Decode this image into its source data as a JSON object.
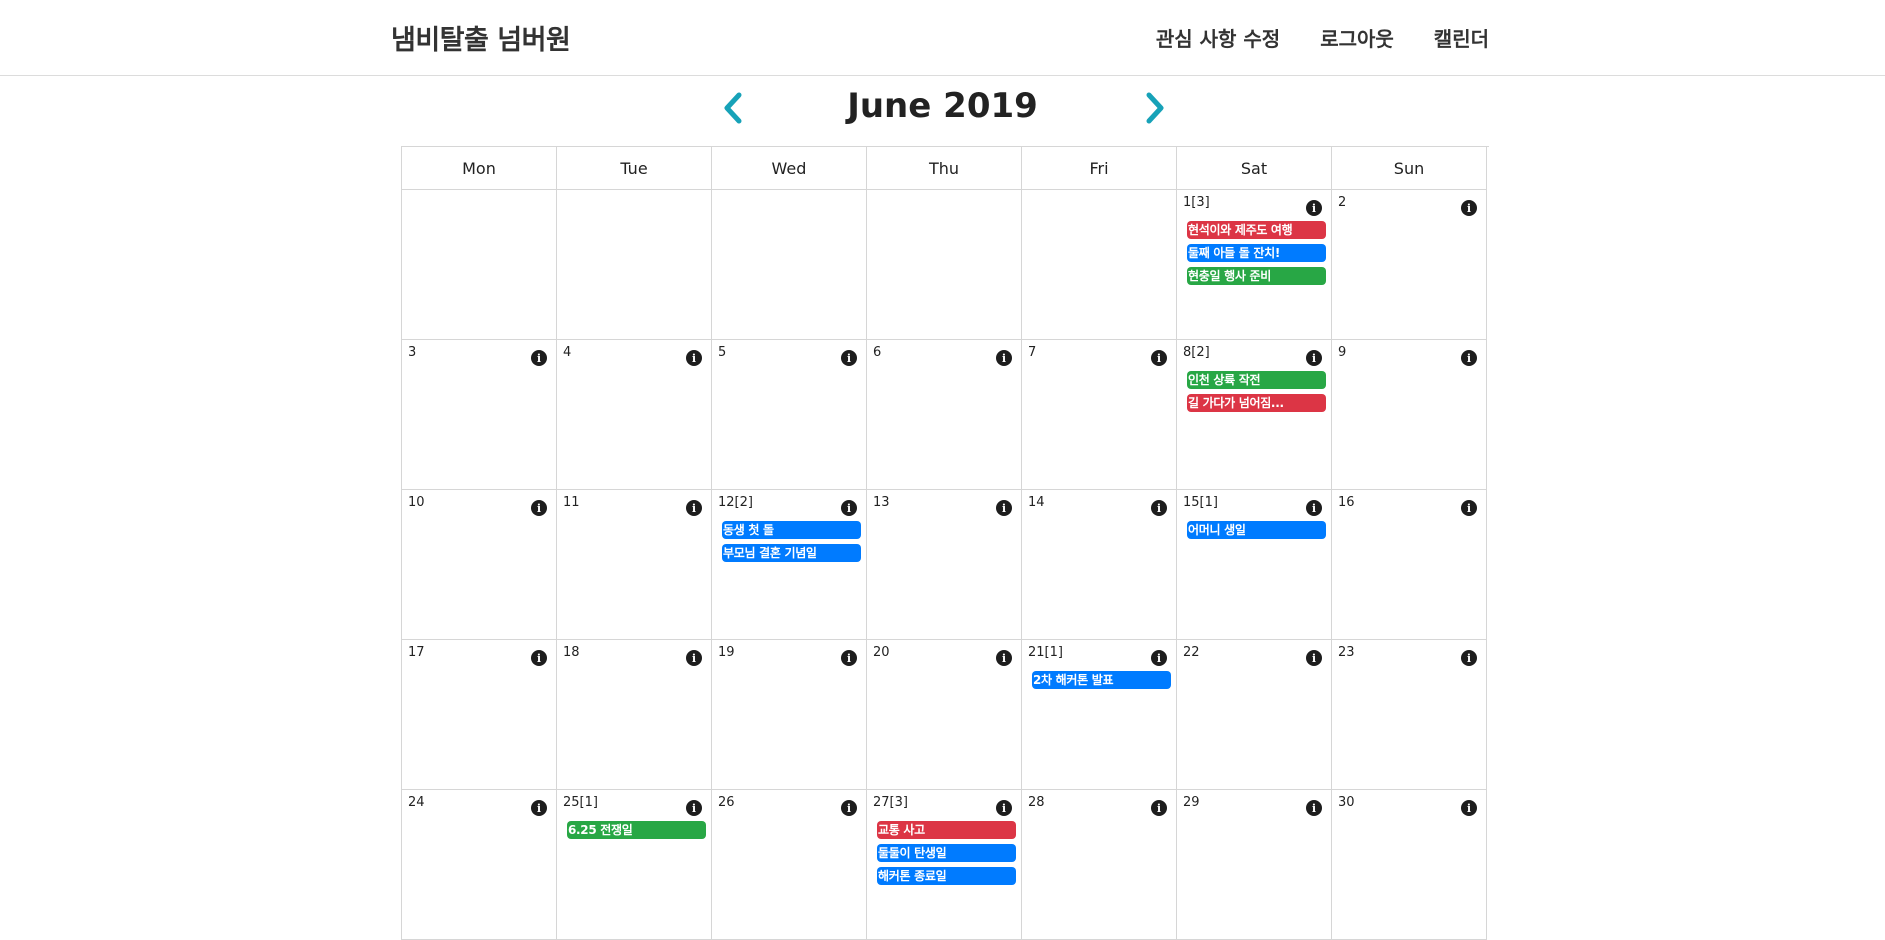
{
  "navbar": {
    "brand": "냄비탈출 넘버원",
    "links": [
      "관심 사항 수정",
      "로그아웃",
      "캘린더"
    ]
  },
  "calendar": {
    "title": "June 2019",
    "weekdays": [
      "Mon",
      "Tue",
      "Wed",
      "Thu",
      "Fri",
      "Sat",
      "Sun"
    ],
    "colors": {
      "red": "#dc3545",
      "blue": "#007bff",
      "green": "#28a745",
      "accent": "#17a2b8"
    },
    "weeks": [
      [
        {
          "label": "",
          "info": false,
          "events": []
        },
        {
          "label": "",
          "info": false,
          "events": []
        },
        {
          "label": "",
          "info": false,
          "events": []
        },
        {
          "label": "",
          "info": false,
          "events": []
        },
        {
          "label": "",
          "info": false,
          "events": []
        },
        {
          "label": "1[3]",
          "info": true,
          "events": [
            {
              "title": "현석이와 제주도 여행",
              "color": "red"
            },
            {
              "title": "둘째 아들 돌 잔치!",
              "color": "blue"
            },
            {
              "title": "현충일 행사 준비",
              "color": "green"
            }
          ]
        },
        {
          "label": "2",
          "info": true,
          "events": []
        }
      ],
      [
        {
          "label": "3",
          "info": true,
          "events": []
        },
        {
          "label": "4",
          "info": true,
          "events": []
        },
        {
          "label": "5",
          "info": true,
          "events": []
        },
        {
          "label": "6",
          "info": true,
          "events": []
        },
        {
          "label": "7",
          "info": true,
          "events": []
        },
        {
          "label": "8[2]",
          "info": true,
          "events": [
            {
              "title": "인천 상륙 작전",
              "color": "green"
            },
            {
              "title": "길 가다가 넘어짐...",
              "color": "red"
            }
          ]
        },
        {
          "label": "9",
          "info": true,
          "events": []
        }
      ],
      [
        {
          "label": "10",
          "info": true,
          "events": []
        },
        {
          "label": "11",
          "info": true,
          "events": []
        },
        {
          "label": "12[2]",
          "info": true,
          "events": [
            {
              "title": "동생 첫 돌",
              "color": "blue"
            },
            {
              "title": "부모님 결혼 기념일",
              "color": "blue"
            }
          ]
        },
        {
          "label": "13",
          "info": true,
          "events": []
        },
        {
          "label": "14",
          "info": true,
          "events": []
        },
        {
          "label": "15[1]",
          "info": true,
          "events": [
            {
              "title": "어머니 생일",
              "color": "blue"
            }
          ]
        },
        {
          "label": "16",
          "info": true,
          "events": []
        }
      ],
      [
        {
          "label": "17",
          "info": true,
          "events": []
        },
        {
          "label": "18",
          "info": true,
          "events": []
        },
        {
          "label": "19",
          "info": true,
          "events": []
        },
        {
          "label": "20",
          "info": true,
          "events": []
        },
        {
          "label": "21[1]",
          "info": true,
          "events": [
            {
              "title": "2차 해커톤 발표",
              "color": "blue"
            }
          ]
        },
        {
          "label": "22",
          "info": true,
          "events": []
        },
        {
          "label": "23",
          "info": true,
          "events": []
        }
      ],
      [
        {
          "label": "24",
          "info": true,
          "events": []
        },
        {
          "label": "25[1]",
          "info": true,
          "events": [
            {
              "title": "6.25 전쟁일",
              "color": "green"
            }
          ]
        },
        {
          "label": "26",
          "info": true,
          "events": []
        },
        {
          "label": "27[3]",
          "info": true,
          "events": [
            {
              "title": "교통 사고",
              "color": "red"
            },
            {
              "title": "둘둘이 탄생일",
              "color": "blue"
            },
            {
              "title": "해커톤 종료일",
              "color": "blue"
            }
          ]
        },
        {
          "label": "28",
          "info": true,
          "events": []
        },
        {
          "label": "29",
          "info": true,
          "events": []
        },
        {
          "label": "30",
          "info": true,
          "events": []
        }
      ]
    ]
  }
}
